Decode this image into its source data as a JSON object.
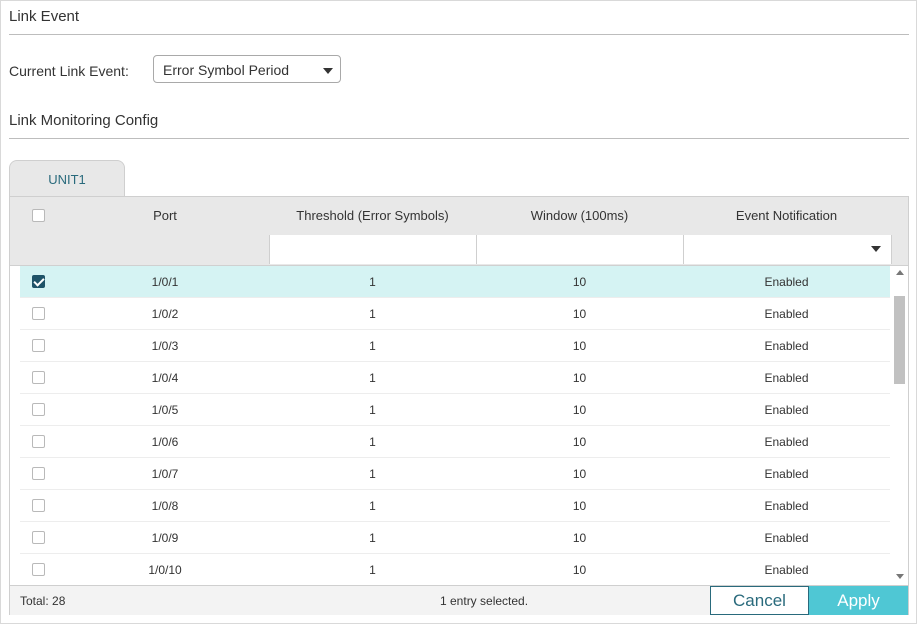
{
  "link_event": {
    "section_title": "Link Event",
    "current_label": "Current Link Event:",
    "current_value": "Error Symbol Period"
  },
  "monitoring": {
    "section_title": "Link Monitoring Config"
  },
  "tabs": [
    {
      "label": "UNIT1"
    }
  ],
  "table": {
    "columns": [
      "Port",
      "Threshold (Error Symbols)",
      "Window (100ms)",
      "Event Notification"
    ],
    "rows": [
      {
        "port": "1/0/1",
        "threshold": "1",
        "window": "10",
        "notification": "Enabled",
        "checked": true
      },
      {
        "port": "1/0/2",
        "threshold": "1",
        "window": "10",
        "notification": "Enabled",
        "checked": false
      },
      {
        "port": "1/0/3",
        "threshold": "1",
        "window": "10",
        "notification": "Enabled",
        "checked": false
      },
      {
        "port": "1/0/4",
        "threshold": "1",
        "window": "10",
        "notification": "Enabled",
        "checked": false
      },
      {
        "port": "1/0/5",
        "threshold": "1",
        "window": "10",
        "notification": "Enabled",
        "checked": false
      },
      {
        "port": "1/0/6",
        "threshold": "1",
        "window": "10",
        "notification": "Enabled",
        "checked": false
      },
      {
        "port": "1/0/7",
        "threshold": "1",
        "window": "10",
        "notification": "Enabled",
        "checked": false
      },
      {
        "port": "1/0/8",
        "threshold": "1",
        "window": "10",
        "notification": "Enabled",
        "checked": false
      },
      {
        "port": "1/0/9",
        "threshold": "1",
        "window": "10",
        "notification": "Enabled",
        "checked": false
      },
      {
        "port": "1/0/10",
        "threshold": "1",
        "window": "10",
        "notification": "Enabled",
        "checked": false
      }
    ]
  },
  "footer": {
    "total": "Total: 28",
    "selection": "1 entry selected.",
    "cancel_label": "Cancel",
    "apply_label": "Apply"
  },
  "colors": {
    "accent": "#4fc7d4",
    "accent_dark": "#296a7c",
    "selected_row": "#d5f3f3",
    "checkbox_checked": "#1e5368"
  }
}
